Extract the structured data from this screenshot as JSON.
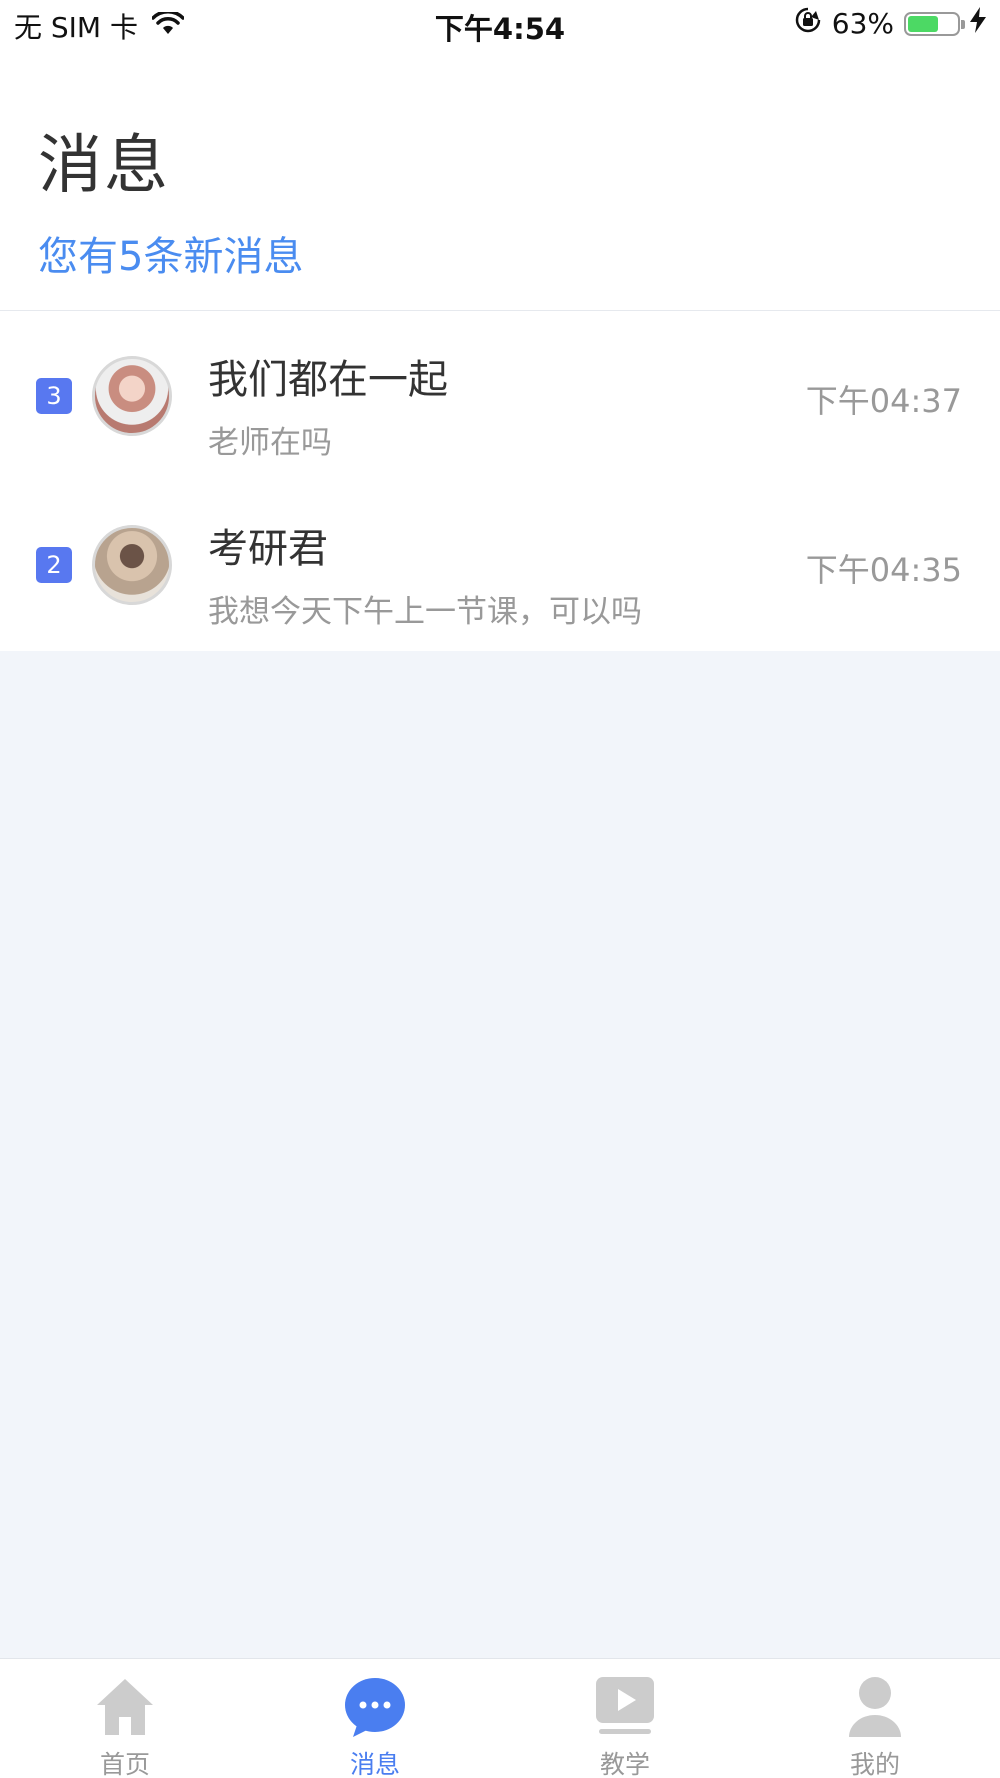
{
  "status_bar": {
    "carrier": "无 SIM 卡",
    "time": "下午4:54",
    "battery_percent": "63%",
    "battery_level": 0.63,
    "wifi_icon": "wifi-icon",
    "orientation_lock_icon": "orientation-lock-icon",
    "charging_icon": "charging-bolt-icon"
  },
  "header": {
    "title": "消息",
    "subtitle": "您有5条新消息"
  },
  "conversations": [
    {
      "unread": "3",
      "name": "我们都在一起",
      "preview": "老师在吗",
      "time": "下午04:37"
    },
    {
      "unread": "2",
      "name": "考研君",
      "preview": "我想今天下午上一节课，可以吗",
      "time": "下午04:35"
    }
  ],
  "tab_bar": {
    "tabs": [
      {
        "label": "首页",
        "icon": "home-icon",
        "active": false
      },
      {
        "label": "消息",
        "icon": "chat-bubble-icon",
        "active": true
      },
      {
        "label": "教学",
        "icon": "play-video-icon",
        "active": false
      },
      {
        "label": "我的",
        "icon": "person-icon",
        "active": false
      }
    ]
  },
  "colors": {
    "accent": "#4a7ef0",
    "subtitle_blue": "#4a8cf0",
    "badge": "#5878f0",
    "background": "#f2f5fa",
    "battery_green": "#4cd964"
  }
}
